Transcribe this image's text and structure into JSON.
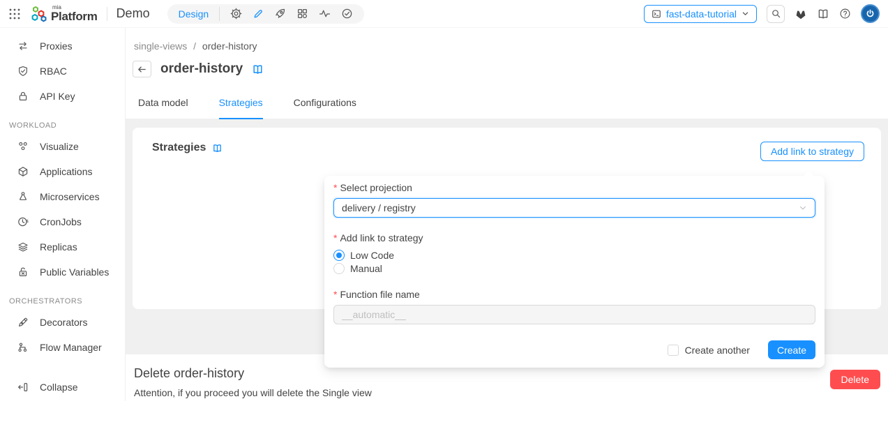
{
  "colors": {
    "accent": "#1890ff",
    "danger": "#ff4d4f",
    "text": "#434343",
    "muted": "#8c8c8c"
  },
  "header": {
    "logo_sup": "mia",
    "logo_text": "Platform",
    "project_name": "Demo",
    "design_label": "Design",
    "env_selector_label": "fast-data-tutorial",
    "pill_icons": [
      "gear-icon",
      "pencil-icon",
      "rocket-icon",
      "dashboard-icon",
      "pulse-icon",
      "check-circle-icon"
    ],
    "right_icons": [
      "search-icon",
      "gitlab-icon",
      "book-icon",
      "help-icon",
      "avatar"
    ]
  },
  "sidebar": {
    "top_items": [
      "Proxies",
      "RBAC",
      "API Key"
    ],
    "workload_header": "WORKLOAD",
    "workload_items": [
      "Visualize",
      "Applications",
      "Microservices",
      "CronJobs",
      "Replicas",
      "Public Variables"
    ],
    "orchestrators_header": "ORCHESTRATORS",
    "orchestrators_items": [
      "Decorators",
      "Flow Manager"
    ],
    "collapse_label": "Collapse"
  },
  "breadcrumb": {
    "parent": "single-views",
    "separator": "/",
    "current": "order-history"
  },
  "page": {
    "title": "order-history"
  },
  "tabs": {
    "items": [
      {
        "label": "Data model"
      },
      {
        "label": "Strategies"
      },
      {
        "label": "Configurations"
      }
    ],
    "active": "Strategies"
  },
  "card": {
    "title": "Strategies",
    "add_link_button": "Add link to strategy"
  },
  "popover": {
    "required_marker": "*",
    "projection_label": "Select projection",
    "projection_value": "delivery / registry",
    "strategy_label": "Add link to strategy",
    "options": [
      {
        "label": "Low Code",
        "selected": true
      },
      {
        "label": "Manual",
        "selected": false
      }
    ],
    "function_label": "Function file name",
    "function_placeholder": "__automatic__",
    "create_another_label": "Create another",
    "create_button_label": "Create"
  },
  "delete_section": {
    "title": "Delete order-history",
    "description": "Attention, if you proceed you will delete the Single view",
    "delete_button_label": "Delete"
  }
}
